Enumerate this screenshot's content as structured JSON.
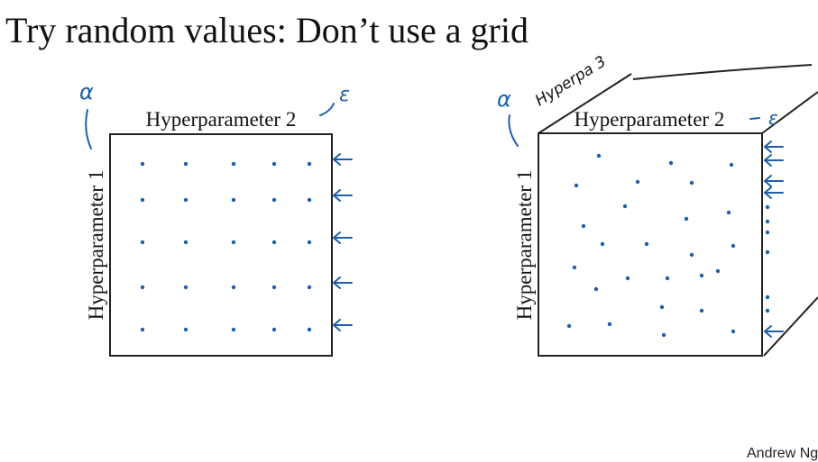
{
  "slide": {
    "title": "Try random values: Don’t use a grid",
    "author": "Andrew Ng",
    "ink_color": "#1f5fa8"
  },
  "left_panel": {
    "label_top": "Hyperparameter 2",
    "label_left": "Hyperparameter 1",
    "annotation_left": "α",
    "annotation_top": "ε",
    "sampling": "grid 5x5"
  },
  "right_panel": {
    "label_top": "Hyperparameter 2",
    "label_left": "Hyperparameter 1",
    "annotation_left": "α",
    "annotation_top": "ε",
    "annotation_depth": "Hyperpa 3",
    "sampling": "random 25 points"
  }
}
